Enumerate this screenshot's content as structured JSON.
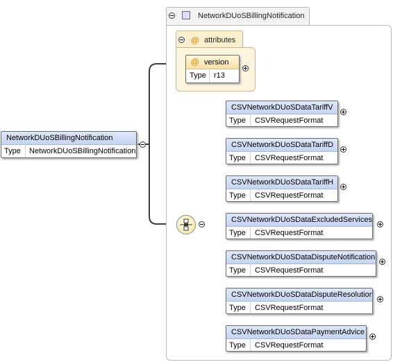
{
  "root": {
    "name": "NetworkDUoSBillingNotification",
    "type_label": "Type",
    "type_value": "NetworkDUoSBillingNotification"
  },
  "complex_type": {
    "name": "NetworkDUoSBillingNotification"
  },
  "attributes": {
    "label": "attributes",
    "at_symbol": "@",
    "items": [
      {
        "name": "version",
        "type_label": "Type",
        "type_value": "r13"
      }
    ]
  },
  "elements": [
    {
      "name": "CSVNetworkDUoSDataTariffV",
      "type_label": "Type",
      "type_value": "CSVRequestFormat"
    },
    {
      "name": "CSVNetworkDUoSDataTariffD",
      "type_label": "Type",
      "type_value": "CSVRequestFormat"
    },
    {
      "name": "CSVNetworkDUoSDataTariffH",
      "type_label": "Type",
      "type_value": "CSVRequestFormat"
    },
    {
      "name": "CSVNetworkDUoSDataExcludedServices",
      "type_label": "Type",
      "type_value": "CSVRequestFormat"
    },
    {
      "name": "CSVNetworkDUoSDataDisputeNotification",
      "type_label": "Type",
      "type_value": "CSVRequestFormat"
    },
    {
      "name": "CSVNetworkDUoSDataDisputeResolution",
      "type_label": "Type",
      "type_value": "CSVRequestFormat"
    },
    {
      "name": "CSVNetworkDUoSDataPaymentAdvice",
      "type_label": "Type",
      "type_value": "CSVRequestFormat"
    }
  ]
}
